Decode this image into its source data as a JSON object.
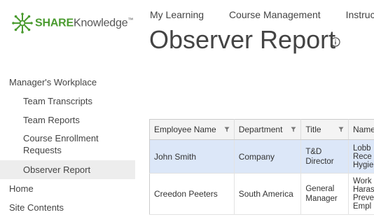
{
  "logo": {
    "share": "SHARE",
    "knowledge": "Knowledge",
    "tm": "™"
  },
  "topnav": [
    "My Learning",
    "Course Management",
    "Instructor-l"
  ],
  "page_title": "Observer Report",
  "sidebar": {
    "heading": "Manager's Workplace",
    "items": [
      {
        "label": "Team Transcripts"
      },
      {
        "label": "Team Reports"
      },
      {
        "label": "Course Enrollment Requests"
      },
      {
        "label": "Observer Report",
        "selected": true
      }
    ],
    "extra": [
      {
        "label": "Home"
      },
      {
        "label": "Site Contents"
      }
    ]
  },
  "table": {
    "columns": [
      "Employee Name",
      "Department",
      "Title",
      "Name"
    ],
    "rows": [
      {
        "employee": "John Smith",
        "department": "Company",
        "title": "T&D Director",
        "name": "Lobb\nRece\nHygie"
      },
      {
        "employee": "Creedon Peeters",
        "department": "South America",
        "title": "General Manager",
        "name": "Work\nHaras\nPreve\nEmpl"
      }
    ]
  },
  "colors": {
    "brand_green": "#4a9b2f",
    "selected_row": "#dce7f8",
    "nav_selected": "#ededed"
  }
}
